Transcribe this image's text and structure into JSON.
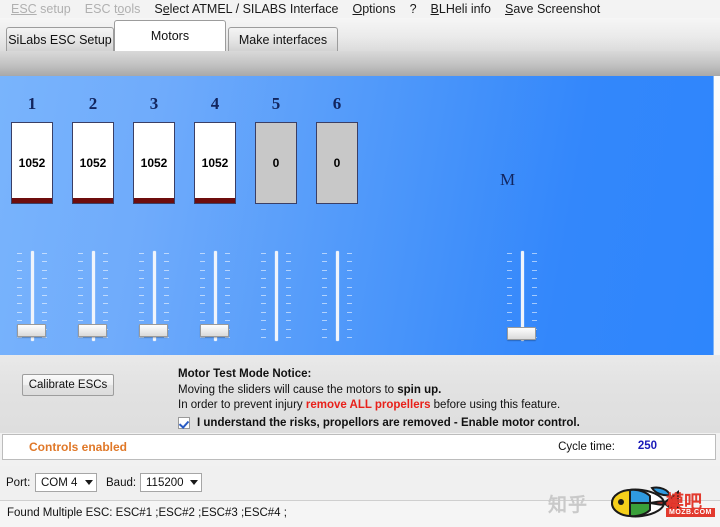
{
  "menu": {
    "items": [
      {
        "label": "ESC setup",
        "accel_index": 2,
        "disabled": true
      },
      {
        "label": "ESC tools",
        "accel_index": 5,
        "disabled": true
      },
      {
        "label": "Select ATMEL / SILABS Interface",
        "accel_index": 1,
        "disabled": false
      },
      {
        "label": "Options",
        "accel_index": 0,
        "disabled": false
      },
      {
        "label": "?",
        "accel_index": -1,
        "disabled": false
      },
      {
        "label": "BLHeli info",
        "accel_index": 1,
        "disabled": false
      },
      {
        "label": "Save Screenshot",
        "accel_index": 0,
        "disabled": false
      }
    ]
  },
  "tabs": [
    {
      "label": "SiLabs ESC Setup",
      "active": false
    },
    {
      "label": "Motors",
      "active": true
    },
    {
      "label": "Make interfaces",
      "active": false
    }
  ],
  "motors": {
    "master_label": "M",
    "channels": [
      {
        "label": "1",
        "value": "1052",
        "enabled": true,
        "slider_percent": 8
      },
      {
        "label": "2",
        "value": "1052",
        "enabled": true,
        "slider_percent": 8
      },
      {
        "label": "3",
        "value": "1052",
        "enabled": true,
        "slider_percent": 8
      },
      {
        "label": "4",
        "value": "1052",
        "enabled": true,
        "slider_percent": 8
      },
      {
        "label": "5",
        "value": "0",
        "enabled": false,
        "slider_percent": 0
      },
      {
        "label": "6",
        "value": "0",
        "enabled": false,
        "slider_percent": 0
      }
    ],
    "master_slider_percent": 5
  },
  "notice": {
    "calibrate_button": "Calibrate ESCs",
    "title": "Motor Test Mode Notice:",
    "line1_pre": "Moving the sliders will cause the motors to ",
    "line1_bold": "spin up.",
    "line2_pre": "In order to prevent injury ",
    "line2_warn": "remove ALL propellers",
    "line2_post": " before using this feature.",
    "checkbox_label": "I understand the risks, propellors are removed - Enable motor control.",
    "checkbox_checked": true
  },
  "status": {
    "controls_text": "Controls enabled",
    "cycle_label": "Cycle time:",
    "cycle_value": "250"
  },
  "port_bar": {
    "port_label": "Port:",
    "port_value": "COM 4",
    "baud_label": "Baud:",
    "baud_value": "115200"
  },
  "log": {
    "text": "Found Multiple ESC: ESC#1 ;ESC#2 ;ESC#3 ;ESC#4 ;"
  },
  "watermark": {
    "zhihu": "知乎",
    "mozb": "模吧",
    "mozb_sub": "MOZB.COM"
  },
  "colors": {
    "panel_blue_left": "#79b4fc",
    "panel_blue_right": "#2e86fc",
    "motor_label_navy": "#12255e",
    "motor_bar_red": "#6e0d0d",
    "warn_red": "#e8201a",
    "status_orange": "#e07828",
    "cycle_blue": "#1a1ab8"
  }
}
